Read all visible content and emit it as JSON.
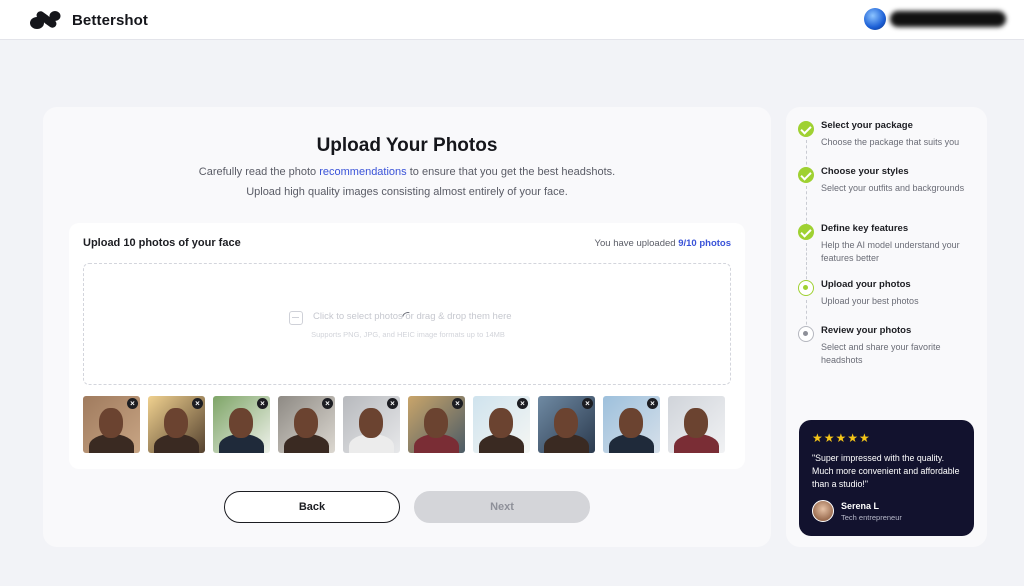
{
  "header": {
    "brand_name": "Bettershot",
    "account_name": "████████████"
  },
  "main": {
    "title": "Upload Your Photos",
    "subtitle_prefix": "Carefully read the photo ",
    "subtitle_link": "recommendations",
    "subtitle_suffix": " to ensure that you get the best headshots.",
    "subtitle_line2": "Upload high quality images consisting almost entirely of your face.",
    "upload": {
      "heading": "Upload 10 photos of your face",
      "count_prefix": "You have uploaded ",
      "count_value": "9/10 photos",
      "dropzone_text": "Click to select photos or drag & drop them here",
      "dropzone_subtext": "Supports PNG, JPG, and HEIC image formats up to 14MB",
      "remove_symbol": "×",
      "thumbnails": [
        {
          "label": "photo-1",
          "removable": true
        },
        {
          "label": "photo-2",
          "removable": true
        },
        {
          "label": "photo-3",
          "removable": true
        },
        {
          "label": "photo-4",
          "removable": true
        },
        {
          "label": "photo-5",
          "removable": true
        },
        {
          "label": "photo-6",
          "removable": true
        },
        {
          "label": "photo-7",
          "removable": true
        },
        {
          "label": "photo-8",
          "removable": true
        },
        {
          "label": "photo-9",
          "removable": true
        },
        {
          "label": "photo-10",
          "removable": false
        }
      ]
    },
    "buttons": {
      "back_label": "Back",
      "next_label": "Next"
    }
  },
  "steps": [
    {
      "title": "Select your package",
      "desc": "Choose the package that suits you",
      "status": "done"
    },
    {
      "title": "Choose your styles",
      "desc": "Select your outfits and backgrounds",
      "status": "done"
    },
    {
      "title": "Define key features",
      "desc": "Help the AI model understand your features better",
      "status": "done"
    },
    {
      "title": "Upload your photos",
      "desc": "Upload your best photos",
      "status": "current"
    },
    {
      "title": "Review your photos",
      "desc": "Select and share your favorite headshots",
      "status": "pending"
    }
  ],
  "testimonial": {
    "stars": "★★★★★",
    "rating": 5,
    "quote": "\"Super impressed with the quality. Much more convenient and affordable than a studio!\"",
    "name": "Serena L",
    "role": "Tech entrepreneur"
  },
  "colors": {
    "accent_link": "#3a53d8",
    "step_done": "#9fd132",
    "testimonial_bg": "#12122e",
    "star": "#f5c518"
  }
}
